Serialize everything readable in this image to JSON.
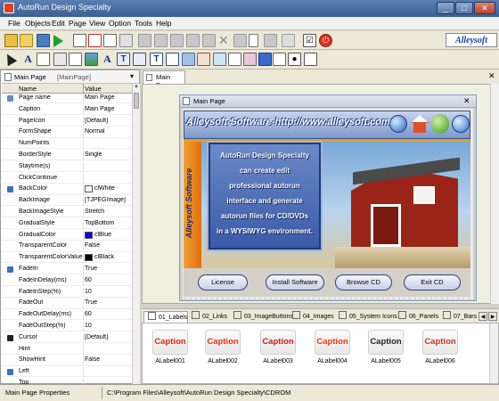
{
  "window": {
    "title": "AutoRun Design Specialty"
  },
  "menu": [
    "File",
    "Objects",
    "Edit",
    "Page",
    "View",
    "Option",
    "Tools",
    "Help"
  ],
  "brand": "Alleysoft",
  "left_panel": {
    "tab_active": "Main Page",
    "tab_inactive": "[MainPage]",
    "header_name": "Name",
    "header_value": "Value",
    "properties": [
      {
        "name": "Page name",
        "value": "Main Page"
      },
      {
        "name": "Caption",
        "value": "Main Page"
      },
      {
        "name": "PageIcon",
        "value": "[Default]"
      },
      {
        "name": "FormShape",
        "value": "Normal"
      },
      {
        "name": "NumPoints",
        "value": ""
      },
      {
        "name": "BorderStyle",
        "value": "Single"
      },
      {
        "name": "Staytime(s)",
        "value": ""
      },
      {
        "name": "ClickContinue",
        "value": ""
      },
      {
        "name": "BackColor",
        "value": "clWhite",
        "swatch": "#ffffff"
      },
      {
        "name": "BackImage",
        "value": "[TJPEGImage]"
      },
      {
        "name": "BackImageStyle",
        "value": "Stretch"
      },
      {
        "name": "GradualStyle",
        "value": "TopBottom"
      },
      {
        "name": "GradualColor",
        "value": "clBlue",
        "swatch": "#0000ff"
      },
      {
        "name": "TransparentColor",
        "value": "False"
      },
      {
        "name": "TransparentColorValue",
        "value": "clBlack",
        "swatch": "#000000"
      },
      {
        "name": "FadeIn",
        "value": "True"
      },
      {
        "name": "FadeInDelay(ms)",
        "value": "60"
      },
      {
        "name": "FadeInStep(%)",
        "value": "10"
      },
      {
        "name": "FadeOut",
        "value": "True"
      },
      {
        "name": "FadeOutDelay(ms)",
        "value": "60"
      },
      {
        "name": "FadeOutStep(%)",
        "value": "10"
      },
      {
        "name": "Cursor",
        "value": "[Default]"
      },
      {
        "name": "Hint",
        "value": ""
      },
      {
        "name": "ShowHint",
        "value": "False"
      },
      {
        "name": "Left",
        "value": ""
      },
      {
        "name": "Top",
        "value": ""
      }
    ]
  },
  "doc_tab": "Main Page",
  "design_window": {
    "title": "Main Page",
    "banner_text": "Alleysoft Software-http://www.alleysoft.com",
    "side_text": "Alleysoft Software",
    "description": [
      "AutoRun Design Specialty",
      "can create edit",
      "professional autorun",
      "interface and generate",
      "autorun files for CD/DVDs",
      "in a WYSIWYG environment."
    ],
    "buttons": [
      "License",
      "Install Software",
      "Browse CD",
      "Exit CD"
    ]
  },
  "palette": {
    "tabs": [
      "01_Labels",
      "02_Links",
      "03_ImageButtons",
      "04_Images",
      "05_System Icons",
      "06_Panels",
      "07_Bars"
    ],
    "items": [
      {
        "caption": "Caption",
        "name": "ALabel001",
        "color": "#e8201a"
      },
      {
        "caption": "Caption",
        "name": "ALabel002",
        "color": "#e83018"
      },
      {
        "caption": "Caption",
        "name": "ALabel003",
        "color": "#d81818"
      },
      {
        "caption": "Caption",
        "name": "ALabel004",
        "color": "#e83c10"
      },
      {
        "caption": "Caption",
        "name": "ALabel005",
        "color": "#222222"
      },
      {
        "caption": "Caption",
        "name": "ALabel006",
        "color": "#c0392b"
      }
    ]
  },
  "status": {
    "left": "Main Page Properties",
    "path": "C:\\Program Files\\Alleysoft\\AutoRun Design Specialty\\CDROM"
  },
  "colors": {
    "title_bar": "#3c5f94",
    "accent_blue": "#0000ff",
    "toolbar": "#ece9d8"
  }
}
